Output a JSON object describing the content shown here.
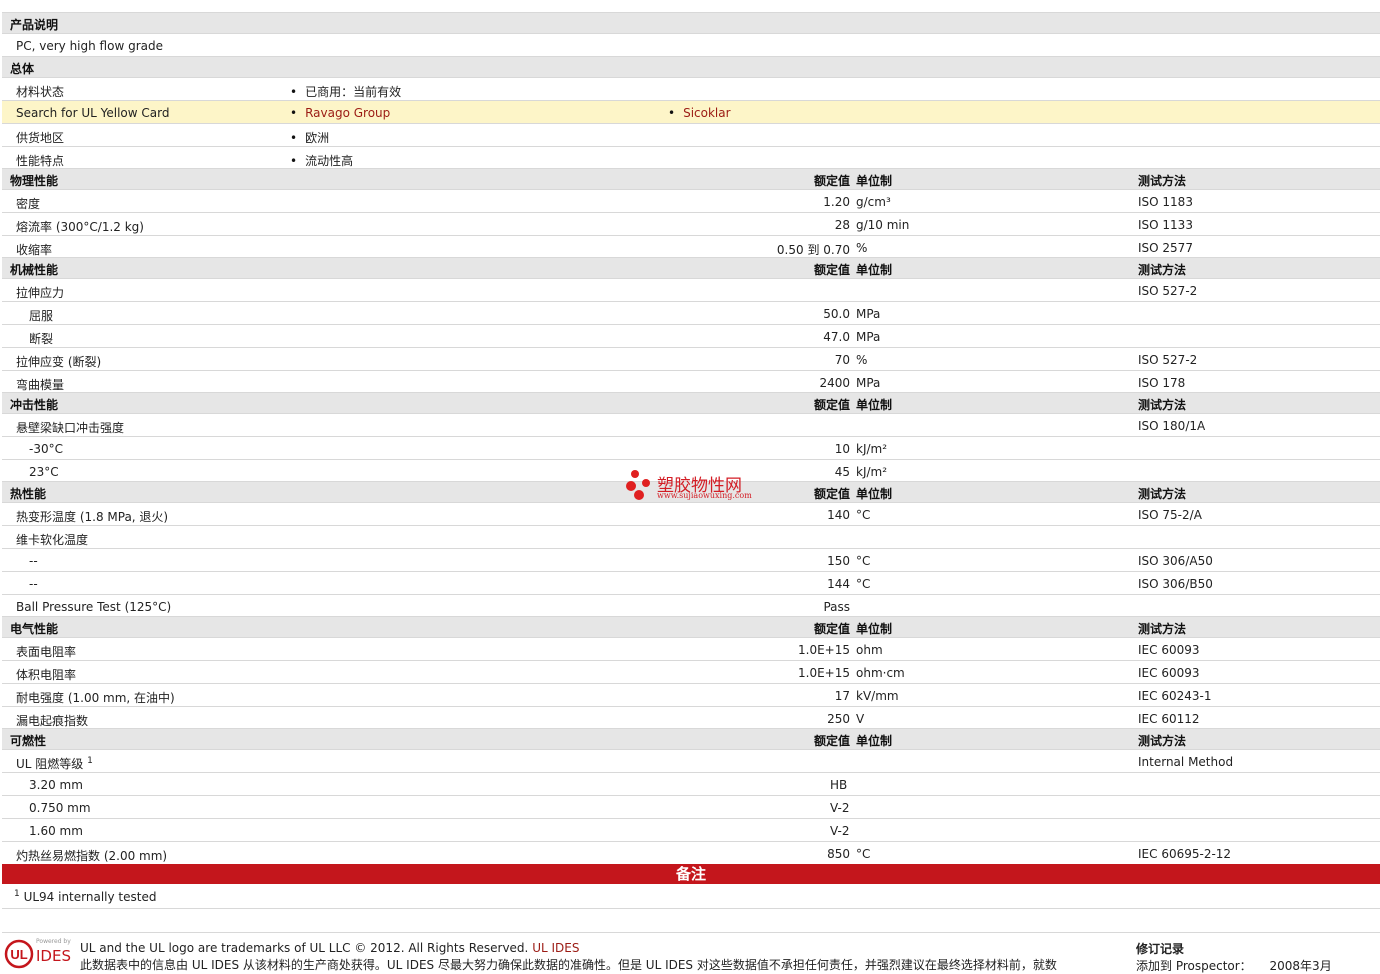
{
  "desc": {
    "title": "产品说明",
    "text": "PC, very high flow grade"
  },
  "general": {
    "title": "总体",
    "rows": {
      "status": {
        "label": "材料状态",
        "value": "已商用：当前有效"
      },
      "yellow_card": {
        "label": "Search for UL Yellow Card",
        "link1": "Ravago Group",
        "link2": "Sicoklar"
      },
      "region": {
        "label": "供货地区",
        "value": "欧洲"
      },
      "features": {
        "label": "性能特点",
        "value": "流动性高"
      }
    }
  },
  "headers": {
    "nominal": "额定值",
    "unit": "单位制",
    "method": "测试方法"
  },
  "physical": {
    "title": "物理性能",
    "rows": [
      {
        "name": "密度",
        "value": "1.20",
        "unit": "g/cm³",
        "method": "ISO 1183"
      },
      {
        "name": "熔流率  (300°C/1.2 kg)",
        "value": "28",
        "unit": "g/10 min",
        "method": "ISO 1133"
      },
      {
        "name": "收缩率",
        "value": "0.50 到  0.70",
        "unit": "%",
        "method": "ISO 2577"
      }
    ]
  },
  "mechanical": {
    "title": "机械性能",
    "rows": [
      {
        "name": "拉伸应力",
        "value": "",
        "unit": "",
        "method": "ISO 527-2"
      },
      {
        "name": "屈服",
        "value": "50.0",
        "unit": "MPa",
        "method": ""
      },
      {
        "name": "断裂",
        "value": "47.0",
        "unit": "MPa",
        "method": ""
      },
      {
        "name": "拉伸应变  (断裂)",
        "value": "70",
        "unit": "%",
        "method": "ISO 527-2"
      },
      {
        "name": "弯曲模量",
        "value": "2400",
        "unit": "MPa",
        "method": "ISO 178"
      }
    ]
  },
  "impact": {
    "title": "冲击性能",
    "rows": [
      {
        "name": "悬壁梁缺口冲击强度",
        "value": "",
        "unit": "",
        "method": "ISO 180/1A"
      },
      {
        "name": "-30°C",
        "value": "10",
        "unit": "kJ/m²",
        "method": ""
      },
      {
        "name": "23°C",
        "value": "45",
        "unit": "kJ/m²",
        "method": ""
      }
    ]
  },
  "thermal": {
    "title": "热性能",
    "rows": [
      {
        "name": "热变形温度  (1.8 MPa, 退火)",
        "value": "140",
        "unit": "°C",
        "method": "ISO 75-2/A"
      },
      {
        "name": "维卡软化温度",
        "value": "",
        "unit": "",
        "method": ""
      },
      {
        "name": "--",
        "value": "150",
        "unit": "°C",
        "method": "ISO 306/A50"
      },
      {
        "name": "--",
        "value": "144",
        "unit": "°C",
        "method": "ISO 306/B50"
      },
      {
        "name": "Ball Pressure Test (125°C)",
        "value": "Pass",
        "unit": "",
        "method": ""
      }
    ]
  },
  "electrical": {
    "title": "电气性能",
    "rows": [
      {
        "name": "表面电阻率",
        "value": "1.0E+15",
        "unit": "ohm",
        "method": "IEC 60093"
      },
      {
        "name": "体积电阻率",
        "value": "1.0E+15",
        "unit": "ohm·cm",
        "method": "IEC 60093"
      },
      {
        "name": "耐电强度  (1.00 mm, 在油中)",
        "value": "17",
        "unit": "kV/mm",
        "method": "IEC 60243-1"
      },
      {
        "name": "漏电起痕指数",
        "value": "250",
        "unit": "V",
        "method": "IEC 60112"
      }
    ]
  },
  "flammability": {
    "title": "可燃性",
    "rows": [
      {
        "name": "UL 阻燃等级",
        "sup": "1",
        "value": "",
        "unit": "",
        "method": "Internal Method"
      },
      {
        "name": "3.20 mm",
        "value": "HB",
        "unit": "",
        "method": ""
      },
      {
        "name": "0.750 mm",
        "value": "V-2",
        "unit": "",
        "method": ""
      },
      {
        "name": "1.60 mm",
        "value": "V-2",
        "unit": "",
        "method": ""
      },
      {
        "name": "灼热丝易燃指数  (2.00 mm)",
        "value": "850",
        "unit": "°C",
        "method": "IEC 60695-2-12"
      }
    ]
  },
  "notes": {
    "title": "备注",
    "sup": "1",
    "text": "UL94 internally tested"
  },
  "watermark": {
    "name": "塑胶物性网",
    "url": "www.sujiaowuxing.com"
  },
  "footer": {
    "trademark": "UL and the UL logo are trademarks of UL LLC © 2012. All Rights Reserved.",
    "ul_ides_link": "UL IDES",
    "disclaimer": "此数据表中的信息由  UL IDES 从该材料的生产商处获得。UL IDES 尽最大努力确保此数据的准确性。但是  UL IDES 对这些数据值不承担任何责任，并强烈建议在最终选择材料前，就数",
    "revision_title": "修订记录",
    "added_label": "添加到  Prospector：",
    "added_date": "2008年3月",
    "logo_powered": "Powered by",
    "logo_ul": "UL",
    "logo_ides": "IDES"
  },
  "colors": {
    "section_bg": "#e6e6e6",
    "highlight_bg": "#fdf5c8",
    "link": "#9b1b14",
    "notes_bar": "#c4161c"
  }
}
